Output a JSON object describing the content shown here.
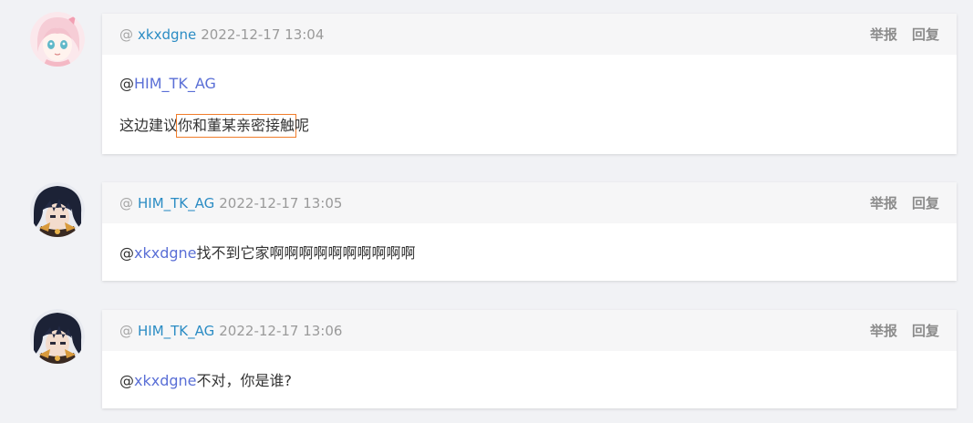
{
  "comments": [
    {
      "author": "xkxdgne",
      "time": "2022-12-17 13:04",
      "reply_to": "HIM_TK_AG",
      "text_before": "这边建议",
      "text_highlight": "你和董某亲密接触",
      "text_after": "呢",
      "report": "举报",
      "reply": "回复"
    },
    {
      "author": "HIM_TK_AG",
      "time": "2022-12-17 13:05",
      "reply_to": "xkxdgne",
      "text": " 找不到它家啊啊啊啊啊啊啊啊啊啊",
      "report": "举报",
      "reply": "回复"
    },
    {
      "author": "HIM_TK_AG",
      "time": "2022-12-17 13:06",
      "reply_to": "xkxdgne",
      "text": " 不对，你是谁?",
      "report": "举报",
      "reply": "回复"
    }
  ],
  "at_symbol": "@",
  "colors": {
    "username": "#2b8cc4",
    "mention": "#5a6fd6",
    "highlight_border": "#f07c2b",
    "header_bg": "#f6f6f7",
    "page_bg": "#f1f2f5"
  },
  "avatars": [
    "anime-girl-avatar-icon",
    "dark-hair-character-avatar-icon",
    "dark-hair-character-avatar-icon"
  ]
}
